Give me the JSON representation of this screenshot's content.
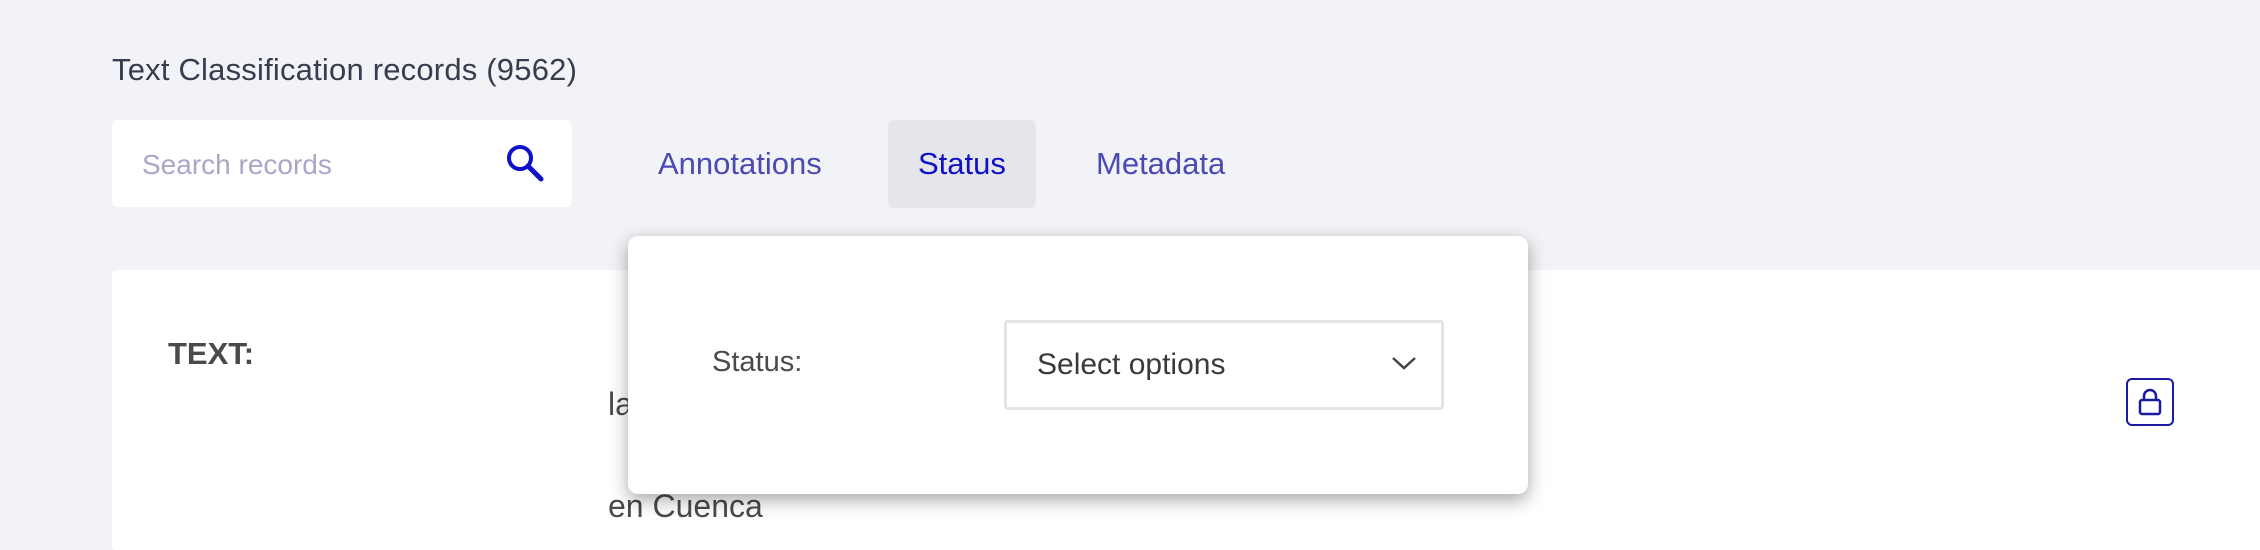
{
  "header": {
    "title": "Text Classification records (9562)"
  },
  "search": {
    "placeholder": "Search records",
    "icon": "search-icon"
  },
  "tabs": [
    {
      "label": "Annotations",
      "active": false
    },
    {
      "label": "Status",
      "active": true
    },
    {
      "label": "Metadata",
      "active": false
    }
  ],
  "record": {
    "field_label": "TEXT:",
    "text_fragments": [
      "la",
      "en Cuenca"
    ],
    "lock_icon": "lock-icon"
  },
  "status_popover": {
    "label": "Status:",
    "select_value": "Select options",
    "chevron_icon": "chevron-down-icon"
  },
  "colors": {
    "background": "#f2f3f7",
    "accent": "#1010c8",
    "tab_text": "#4a4ab0",
    "active_tab_bg": "#e5e6ec"
  }
}
